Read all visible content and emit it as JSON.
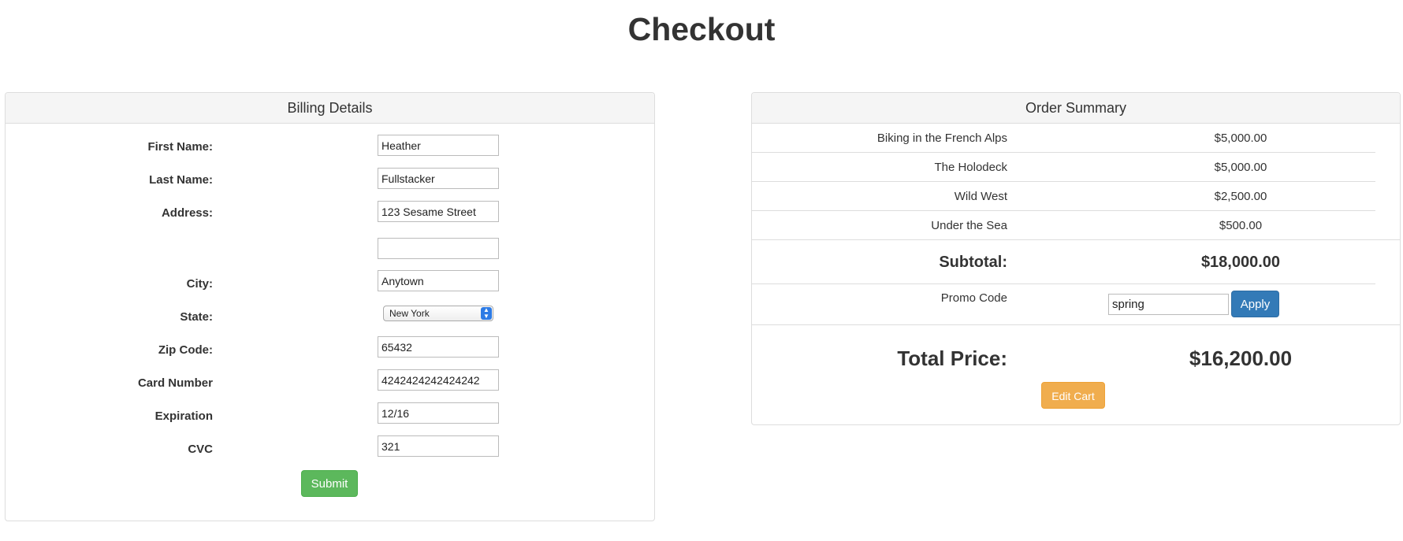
{
  "page": {
    "title": "Checkout"
  },
  "billing": {
    "heading": "Billing Details",
    "fields": {
      "first_name": {
        "label": "First Name:",
        "value": "Heather"
      },
      "last_name": {
        "label": "Last Name:",
        "value": "Fullstacker"
      },
      "address": {
        "label": "Address:",
        "value": "123 Sesame Street"
      },
      "address2": {
        "value": ""
      },
      "city": {
        "label": "City:",
        "value": "Anytown"
      },
      "state": {
        "label": "State:",
        "value": "New York"
      },
      "zip": {
        "label": "Zip Code:",
        "value": "65432"
      },
      "card_number": {
        "label": "Card Number",
        "value": "4242424242424242"
      },
      "expiration": {
        "label": "Expiration",
        "value": "12/16"
      },
      "cvc": {
        "label": "CVC",
        "value": "321"
      }
    },
    "submit_label": "Submit"
  },
  "summary": {
    "heading": "Order Summary",
    "items": [
      {
        "name": "Biking in the French Alps",
        "price": "$5,000.00"
      },
      {
        "name": "The Holodeck",
        "price": "$5,000.00"
      },
      {
        "name": "Wild West",
        "price": "$2,500.00"
      },
      {
        "name": "Under the Sea",
        "price": "$500.00"
      }
    ],
    "subtotal_label": "Subtotal:",
    "subtotal_value": "$18,000.00",
    "promo_label": "Promo Code",
    "promo_value": "spring",
    "apply_label": "Apply",
    "total_label": "Total Price:",
    "total_value": "$16,200.00",
    "edit_cart_label": "Edit Cart"
  },
  "colors": {
    "submit": "#5cb85c",
    "apply": "#337ab7",
    "edit_cart": "#f0ad4e",
    "panel_border": "#dddddd",
    "panel_heading_bg": "#f5f5f5"
  }
}
